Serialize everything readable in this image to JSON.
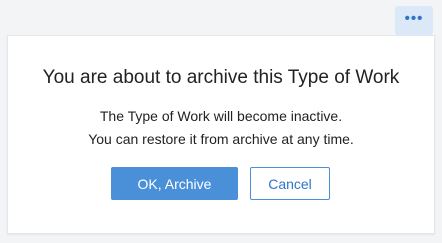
{
  "header": {
    "more_icon": "more-horizontal-icon",
    "more_glyph": "•••"
  },
  "dialog": {
    "title": "You are about to archive this Type of Work",
    "message_line1": "The Type of Work will become inactive.",
    "message_line2": "You can restore it from archive at any time.",
    "confirm_label": "OK, Archive",
    "cancel_label": "Cancel"
  },
  "colors": {
    "accent": "#4a90d9",
    "accent_text": "#2f75c9",
    "more_button_bg": "#dbe8f8"
  }
}
